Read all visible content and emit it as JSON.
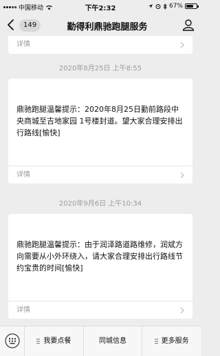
{
  "status_bar": {
    "carrier": "中国移动",
    "time": "下午2:32",
    "battery": "67%"
  },
  "nav": {
    "badge": "149",
    "title": "勤得利鼎驰跑腿服务"
  },
  "top_card": {
    "details_label": "详情"
  },
  "messages": [
    {
      "timestamp": "2020年8月25日 上午8:55",
      "body": "鼎驰跑腿温馨提示：2020年8月25日勤前路段中央商城至吉地家园 1号楼封道。望大家合理安排出行路线[愉快]",
      "details_label": "详情"
    },
    {
      "timestamp": "2020年9月6日 上午10:34",
      "body": "鼎驰跑腿温馨提示：由于润泽路道路维修，润斌方向需要从小外环绕入，请大家合理安排出行路线节约宝贵的时间[愉快]",
      "details_label": "详情"
    }
  ],
  "bottom_menu": [
    {
      "label": "我要点餐"
    },
    {
      "label": "同城信息"
    },
    {
      "label": "更多服务"
    }
  ]
}
